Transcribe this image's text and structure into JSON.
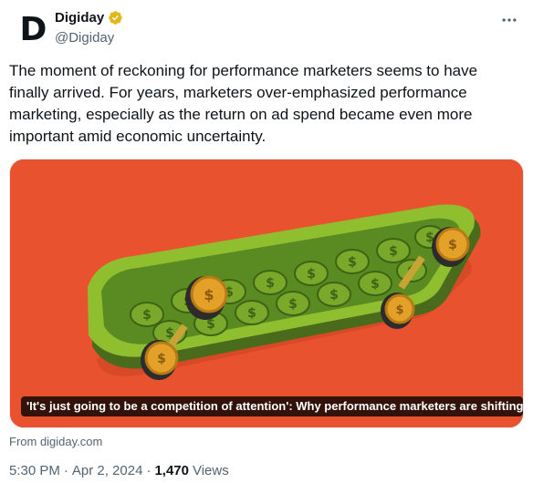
{
  "author": {
    "display_name": "Digiday",
    "handle": "@Digiday",
    "avatar_letter": "D",
    "verified": true,
    "verified_color": "#e2b719"
  },
  "tweet": {
    "text": "The moment of reckoning for performance marketers seems to have finally arrived. For years, marketers over-emphasized performance marketing, especially as the return on ad spend became even more important amid economic uncertainty."
  },
  "link_card": {
    "title": "'It's just going to be a competition of attention': Why performance marketers are shifting...",
    "source": "From digiday.com",
    "background_color": "#e8522f"
  },
  "meta": {
    "time": "5:30 PM",
    "separator": "·",
    "date": "Apr 2, 2024",
    "views_count": "1,470",
    "views_label": "Views"
  },
  "icons": {
    "more": "more-horizontal-icon",
    "verified": "verified-badge-icon"
  }
}
